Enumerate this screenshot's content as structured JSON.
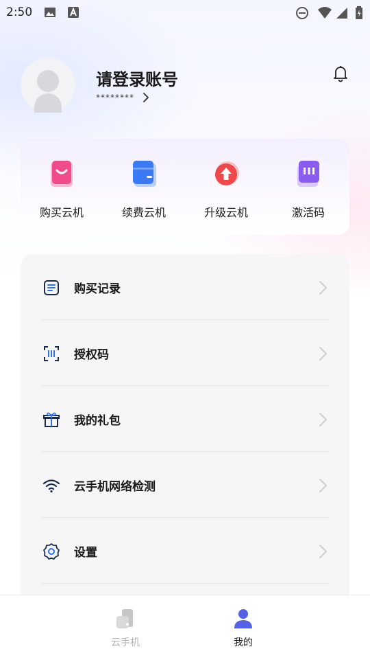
{
  "status_bar": {
    "time": "2:50",
    "icons": [
      "image-icon",
      "a-icon",
      "dnd-icon",
      "wifi-icon",
      "signal-icon",
      "battery-icon"
    ]
  },
  "header": {
    "login_title": "请登录账号",
    "account_masked": "********",
    "bell_icon": "bell-icon"
  },
  "quick_actions": [
    {
      "label": "购买云机",
      "icon": "shopping-bag-icon",
      "color": "#f04b8c"
    },
    {
      "label": "续费云机",
      "icon": "wallet-icon",
      "color": "#3a7bf5"
    },
    {
      "label": "升级云机",
      "icon": "upgrade-icon",
      "color": "#f0474b"
    },
    {
      "label": "激活码",
      "icon": "code-icon",
      "color": "#8a5cf0"
    }
  ],
  "menu": [
    {
      "label": "购买记录",
      "icon": "document-icon"
    },
    {
      "label": "授权码",
      "icon": "scan-code-icon"
    },
    {
      "label": "我的礼包",
      "icon": "gift-icon"
    },
    {
      "label": "云手机网络检测",
      "icon": "wifi-icon"
    },
    {
      "label": "设置",
      "icon": "gear-icon"
    }
  ],
  "bottom_nav": [
    {
      "label": "云手机",
      "icon": "cloud-phone-icon",
      "active": false
    },
    {
      "label": "我的",
      "icon": "user-icon",
      "active": true
    }
  ],
  "colors": {
    "accent": "#5562e8",
    "inactive": "#b5b5b5",
    "text": "#1a1a1a"
  }
}
